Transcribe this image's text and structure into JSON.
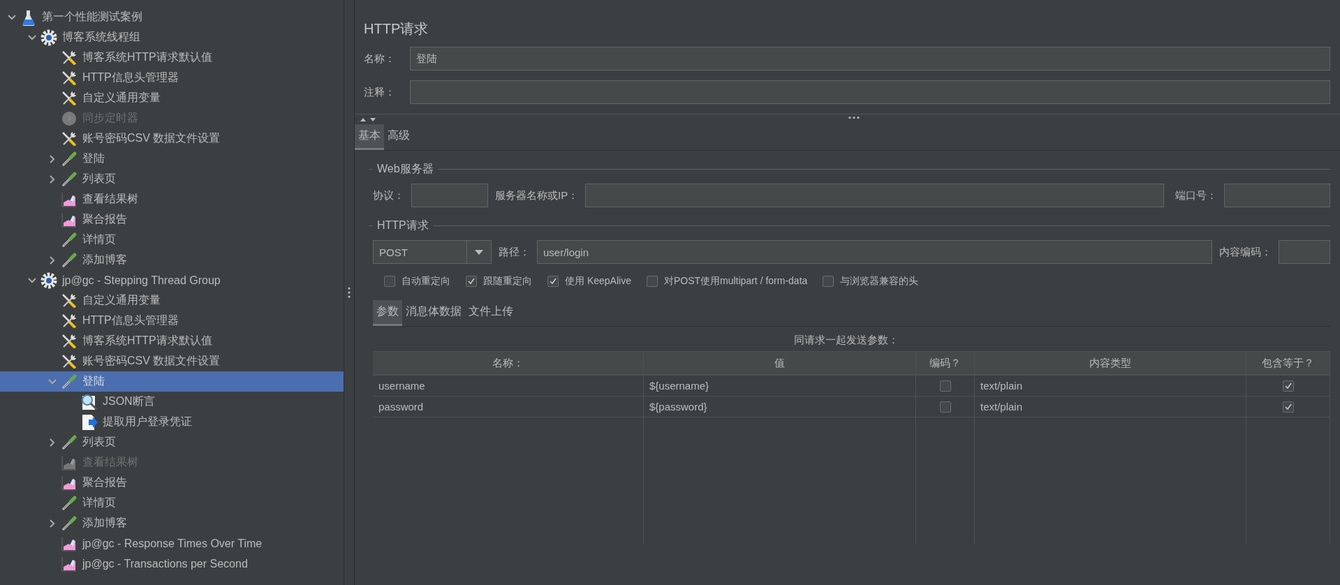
{
  "tree": {
    "kind": "testplan",
    "label": "第一个性能测试案例",
    "expanded": true,
    "selected": false,
    "disabled": false,
    "children": [
      {
        "kind": "threadgroup",
        "label": "博客系统线程组",
        "expanded": true,
        "selected": false,
        "disabled": false,
        "children": [
          {
            "kind": "config",
            "label": "博客系统HTTP请求默认值",
            "selected": false,
            "disabled": false
          },
          {
            "kind": "config",
            "label": "HTTP信息头管理器",
            "selected": false,
            "disabled": false
          },
          {
            "kind": "config",
            "label": "自定义通用变量",
            "selected": false,
            "disabled": false
          },
          {
            "kind": "timer",
            "label": "同步定时器",
            "selected": false,
            "disabled": true
          },
          {
            "kind": "config",
            "label": "账号密码CSV 数据文件设置",
            "selected": false,
            "disabled": false
          },
          {
            "kind": "sampler",
            "label": "登陆",
            "expanded": false,
            "selected": false,
            "disabled": false
          },
          {
            "kind": "sampler",
            "label": "列表页",
            "expanded": false,
            "selected": false,
            "disabled": false
          },
          {
            "kind": "listener",
            "label": "查看结果树",
            "selected": false,
            "disabled": false
          },
          {
            "kind": "listener",
            "label": "聚合报告",
            "selected": false,
            "disabled": false
          },
          {
            "kind": "sampler",
            "label": "详情页",
            "selected": false,
            "disabled": false
          },
          {
            "kind": "sampler",
            "label": "添加博客",
            "expanded": false,
            "selected": false,
            "disabled": false
          }
        ]
      },
      {
        "kind": "threadgroup",
        "label": "jp@gc - Stepping Thread Group",
        "expanded": true,
        "selected": false,
        "disabled": false,
        "children": [
          {
            "kind": "config",
            "label": "自定义通用变量",
            "selected": false,
            "disabled": false
          },
          {
            "kind": "config",
            "label": "HTTP信息头管理器",
            "selected": false,
            "disabled": false
          },
          {
            "kind": "config",
            "label": "博客系统HTTP请求默认值",
            "selected": false,
            "disabled": false
          },
          {
            "kind": "config",
            "label": "账号密码CSV 数据文件设置",
            "selected": false,
            "disabled": false
          },
          {
            "kind": "sampler",
            "label": "登陆",
            "expanded": true,
            "selected": true,
            "disabled": false,
            "children": [
              {
                "kind": "assertion",
                "label": "JSON断言",
                "selected": false,
                "disabled": false
              },
              {
                "kind": "extractor",
                "label": "提取用户登录凭证",
                "selected": false,
                "disabled": false
              }
            ]
          },
          {
            "kind": "sampler",
            "label": "列表页",
            "expanded": false,
            "selected": false,
            "disabled": false
          },
          {
            "kind": "listener",
            "label": "查看结果树",
            "selected": false,
            "disabled": true
          },
          {
            "kind": "listener",
            "label": "聚合报告",
            "selected": false,
            "disabled": false
          },
          {
            "kind": "sampler",
            "label": "详情页",
            "selected": false,
            "disabled": false
          },
          {
            "kind": "sampler",
            "label": "添加博客",
            "expanded": false,
            "selected": false,
            "disabled": false
          },
          {
            "kind": "listener",
            "label": "jp@gc - Response Times Over Time",
            "selected": false,
            "disabled": false
          },
          {
            "kind": "listener",
            "label": "jp@gc - Transactions per Second",
            "selected": false,
            "disabled": false
          }
        ]
      }
    ]
  },
  "panel": {
    "title": "HTTP请求",
    "name_label": "名称：",
    "name_value": "登陆",
    "comment_label": "注释：",
    "tabs": [
      {
        "label": "基本",
        "selected": true
      },
      {
        "label": "高级",
        "selected": false
      }
    ],
    "web_server": {
      "legend": "Web服务器",
      "protocol_label": "协议：",
      "server_label": "服务器名称或IP：",
      "port_label": "端口号："
    },
    "http_request": {
      "legend": "HTTP请求",
      "method": "POST",
      "path_label": "路径：",
      "path_value": "user/login",
      "encoding_label": "内容编码：",
      "options": [
        {
          "label": "自动重定向",
          "checked": false
        },
        {
          "label": "跟随重定向",
          "checked": true
        },
        {
          "label": "使用 KeepAlive",
          "checked": true
        },
        {
          "label": "对POST使用multipart / form-data",
          "checked": false
        },
        {
          "label": "与浏览器兼容的头",
          "checked": false
        }
      ]
    },
    "sub_tabs": [
      {
        "label": "参数",
        "selected": true
      },
      {
        "label": "消息体数据",
        "selected": false
      },
      {
        "label": "文件上传",
        "selected": false
      }
    ],
    "params": {
      "caption": "同请求一起发送参数：",
      "columns": [
        "名称：",
        "值",
        "编码？",
        "内容类型",
        "包含等于？"
      ],
      "rows": [
        {
          "name": "username",
          "value": "${username}",
          "encode": false,
          "content_type": "text/plain",
          "include_equals": true
        },
        {
          "name": "password",
          "value": "${password}",
          "encode": false,
          "content_type": "text/plain",
          "include_equals": true
        }
      ]
    }
  }
}
